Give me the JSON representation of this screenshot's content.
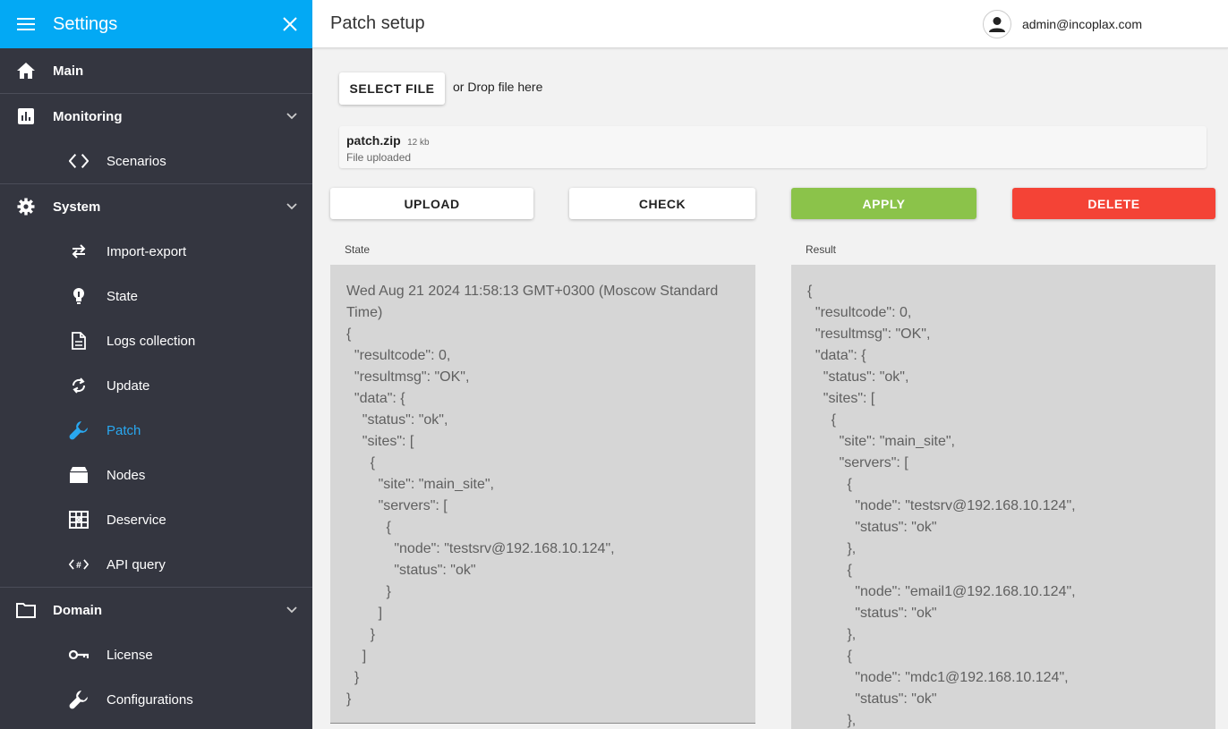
{
  "sidebar": {
    "title": "Settings",
    "items": [
      {
        "label": "Main",
        "icon": "home-icon",
        "level": "top"
      },
      {
        "label": "Monitoring",
        "icon": "chart-icon",
        "level": "top",
        "expandable": true
      },
      {
        "label": "Scenarios",
        "icon": "code-icon",
        "level": "sub"
      },
      {
        "label": "System",
        "icon": "gear-icon",
        "level": "top",
        "expandable": true
      },
      {
        "label": "Import-export",
        "icon": "swap-icon",
        "level": "sub"
      },
      {
        "label": "State",
        "icon": "bulb-icon",
        "level": "sub"
      },
      {
        "label": "Logs collection",
        "icon": "file-icon",
        "level": "sub"
      },
      {
        "label": "Update",
        "icon": "sync-icon",
        "level": "sub"
      },
      {
        "label": "Patch",
        "icon": "wrench-icon",
        "level": "sub",
        "active": true
      },
      {
        "label": "Nodes",
        "icon": "storage-icon",
        "level": "sub"
      },
      {
        "label": "Deservice",
        "icon": "grid-icon",
        "level": "sub"
      },
      {
        "label": "API query",
        "icon": "api-icon",
        "level": "sub"
      },
      {
        "label": "Domain",
        "icon": "folder-icon",
        "level": "top",
        "expandable": true
      },
      {
        "label": "License",
        "icon": "key-icon",
        "level": "sub"
      },
      {
        "label": "Configurations",
        "icon": "wrench-icon",
        "level": "sub"
      }
    ]
  },
  "topbar": {
    "page_title": "Patch setup",
    "user_email": "admin@incoplax.com"
  },
  "upload": {
    "select_file_label": "SELECT FILE",
    "drop_text": "or Drop file here",
    "file_name": "patch.zip",
    "file_size": "12 kb",
    "file_status": "File uploaded"
  },
  "actions": {
    "upload_label": "UPLOAD",
    "check_label": "CHECK",
    "apply_label": "APPLY",
    "delete_label": "DELETE"
  },
  "colors": {
    "accent": "#03a9f4",
    "sidebar_bg": "#343640",
    "active_item": "#29a8f0",
    "apply": "#8bc34a",
    "delete": "#f44336"
  },
  "state_panel": {
    "label": "State",
    "content": "Wed Aug 21 2024 11:58:13 GMT+0300 (Moscow Standard Time)\n{\n  \"resultcode\": 0,\n  \"resultmsg\": \"OK\",\n  \"data\": {\n    \"status\": \"ok\",\n    \"sites\": [\n      {\n        \"site\": \"main_site\",\n        \"servers\": [\n          {\n            \"node\": \"testsrv@192.168.10.124\",\n            \"status\": \"ok\"\n          }\n        ]\n      }\n    ]\n  }\n}"
  },
  "result_panel": {
    "label": "Result",
    "content": "{\n  \"resultcode\": 0,\n  \"resultmsg\": \"OK\",\n  \"data\": {\n    \"status\": \"ok\",\n    \"sites\": [\n      {\n        \"site\": \"main_site\",\n        \"servers\": [\n          {\n            \"node\": \"testsrv@192.168.10.124\",\n            \"status\": \"ok\"\n          },\n          {\n            \"node\": \"email1@192.168.10.124\",\n            \"status\": \"ok\"\n          },\n          {\n            \"node\": \"mdc1@192.168.10.124\",\n            \"status\": \"ok\"\n          },"
  }
}
